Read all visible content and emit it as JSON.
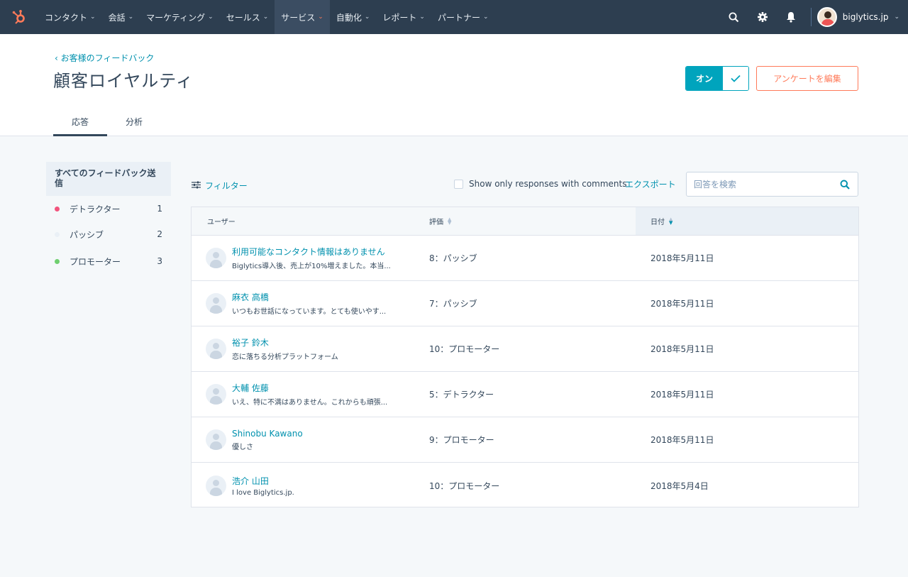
{
  "nav": {
    "items": [
      {
        "label": "コンタクト",
        "active": false
      },
      {
        "label": "会話",
        "active": false
      },
      {
        "label": "マーケティング",
        "active": false
      },
      {
        "label": "セールス",
        "active": false
      },
      {
        "label": "サービス",
        "active": true
      },
      {
        "label": "自動化",
        "active": false
      },
      {
        "label": "レポート",
        "active": false
      },
      {
        "label": "パートナー",
        "active": false
      }
    ],
    "account": "biglytics.jp",
    "accent": "#ff7a59"
  },
  "header": {
    "back_link": "お客様のフィードバック",
    "title": "顧客ロイヤルティ",
    "toggle_label": "オン",
    "edit_button": "アンケートを編集",
    "tabs": [
      "応答",
      "分析"
    ]
  },
  "sidebar": {
    "heading": "すべてのフィードバック送信",
    "items": [
      {
        "label": "デトラクター",
        "count": "1",
        "color": "#f2547d"
      },
      {
        "label": "パッシブ",
        "count": "2",
        "color": "#eaf0f6"
      },
      {
        "label": "プロモーター",
        "count": "3",
        "color": "#6fcf6f"
      }
    ]
  },
  "toolbar": {
    "filter": "フィルター",
    "comments_only": "Show only responses with comments",
    "export": "エクスポート",
    "search_placeholder": "回答を検索"
  },
  "table": {
    "columns": [
      "ユーザー",
      "評価",
      "日付"
    ],
    "rows": [
      {
        "name": "利用可能なコンタクト情報はありません",
        "comment": "Biglytics導入後、売上が10%増えました。本当...",
        "rating": "8：パッシブ",
        "date": "2018年5月11日"
      },
      {
        "name": "麻衣 高橋",
        "comment": "いつもお世話になっています。とても使いやす...",
        "rating": "7：パッシブ",
        "date": "2018年5月11日"
      },
      {
        "name": "裕子 鈴木",
        "comment": "恋に落ちる分析プラットフォーム",
        "rating": "10：プロモーター",
        "date": "2018年5月11日"
      },
      {
        "name": "大輔 佐藤",
        "comment": "いえ、特に不満はありません。これからも頑張...",
        "rating": "5：デトラクター",
        "date": "2018年5月11日"
      },
      {
        "name": "Shinobu Kawano",
        "comment": "優しさ",
        "rating": "9：プロモーター",
        "date": "2018年5月11日"
      },
      {
        "name": "浩介 山田",
        "comment": "I love Biglytics.jp.",
        "rating": "10：プロモーター",
        "date": "2018年5月4日"
      }
    ]
  }
}
